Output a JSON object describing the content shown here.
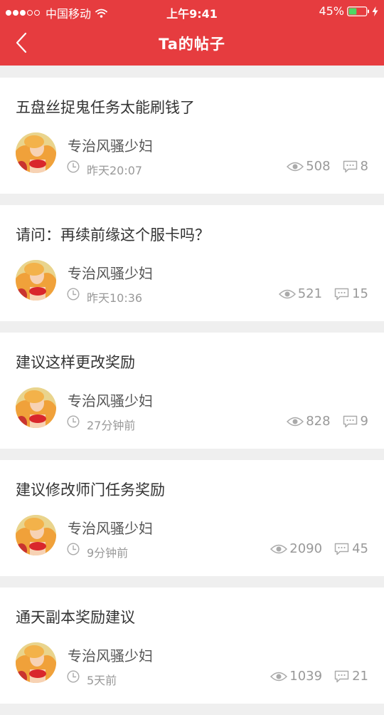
{
  "status_bar": {
    "carrier": "中国移动",
    "time": "上午9:41",
    "battery_percent": "45%",
    "battery_level": 0.45,
    "signal_bars": 3,
    "signal_total": 5
  },
  "nav": {
    "title": "Ta的帖子",
    "back_icon": "chevron-left-icon"
  },
  "colors": {
    "header_bg": "#e63c3f",
    "page_bg": "#efefef",
    "battery_fill": "#4cd964"
  },
  "posts": [
    {
      "title": "五盘丝捉鬼任务太能刷钱了",
      "author": "专治风骚少妇",
      "time": "昨天20:07",
      "views": "508",
      "comments": "8"
    },
    {
      "title": "请问：再续前缘这个服卡吗？",
      "author": "专治风骚少妇",
      "time": "昨天10:36",
      "views": "521",
      "comments": "15"
    },
    {
      "title": "建议这样更改奖励",
      "author": "专治风骚少妇",
      "time": "27分钟前",
      "views": "828",
      "comments": "9"
    },
    {
      "title": "建议修改师门任务奖励",
      "author": "专治风骚少妇",
      "time": "9分钟前",
      "views": "2090",
      "comments": "45"
    },
    {
      "title": "通天副本奖励建议",
      "author": "专治风骚少妇",
      "time": "5天前",
      "views": "1039",
      "comments": "21"
    }
  ]
}
